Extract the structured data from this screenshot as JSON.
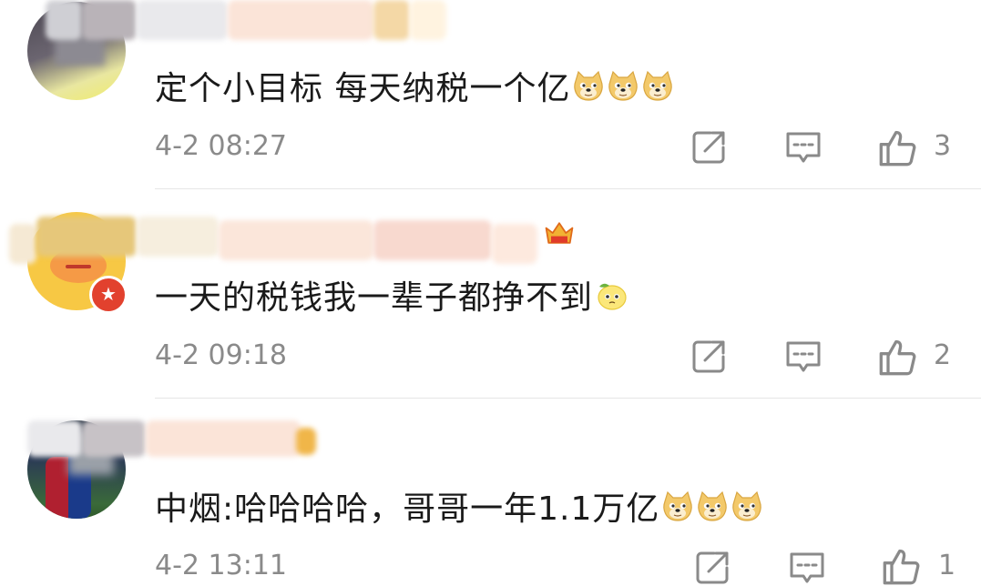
{
  "comments": [
    {
      "text": "定个小目标 每天纳税一个亿",
      "emoji_count": 3,
      "emoji_icon": "doge-emoji-icon",
      "time": "4-2 08:27",
      "likes": "3"
    },
    {
      "text": "一天的税钱我一辈子都挣不到",
      "emoji_count": 1,
      "emoji_icon": "pleading-lemon-emoji-icon",
      "time": "4-2 09:18",
      "likes": "2"
    },
    {
      "text": "中烟:哈哈哈哈，哥哥一年1.1万亿",
      "emoji_count": 3,
      "emoji_icon": "doge-emoji-icon",
      "time": "4-2 13:11",
      "likes": "1"
    }
  ],
  "icons": {
    "share": "share-icon",
    "reply": "comment-icon",
    "like": "thumbs-up-icon",
    "vip_badge": "vip-badge-icon",
    "crown_badge": "crown-badge-icon"
  },
  "colors": {
    "text": "#1a1a1a",
    "meta": "#8a8a8a",
    "divider": "#e6e6e6",
    "doge": "#f3c96a",
    "vip_red": "#e2412e"
  }
}
